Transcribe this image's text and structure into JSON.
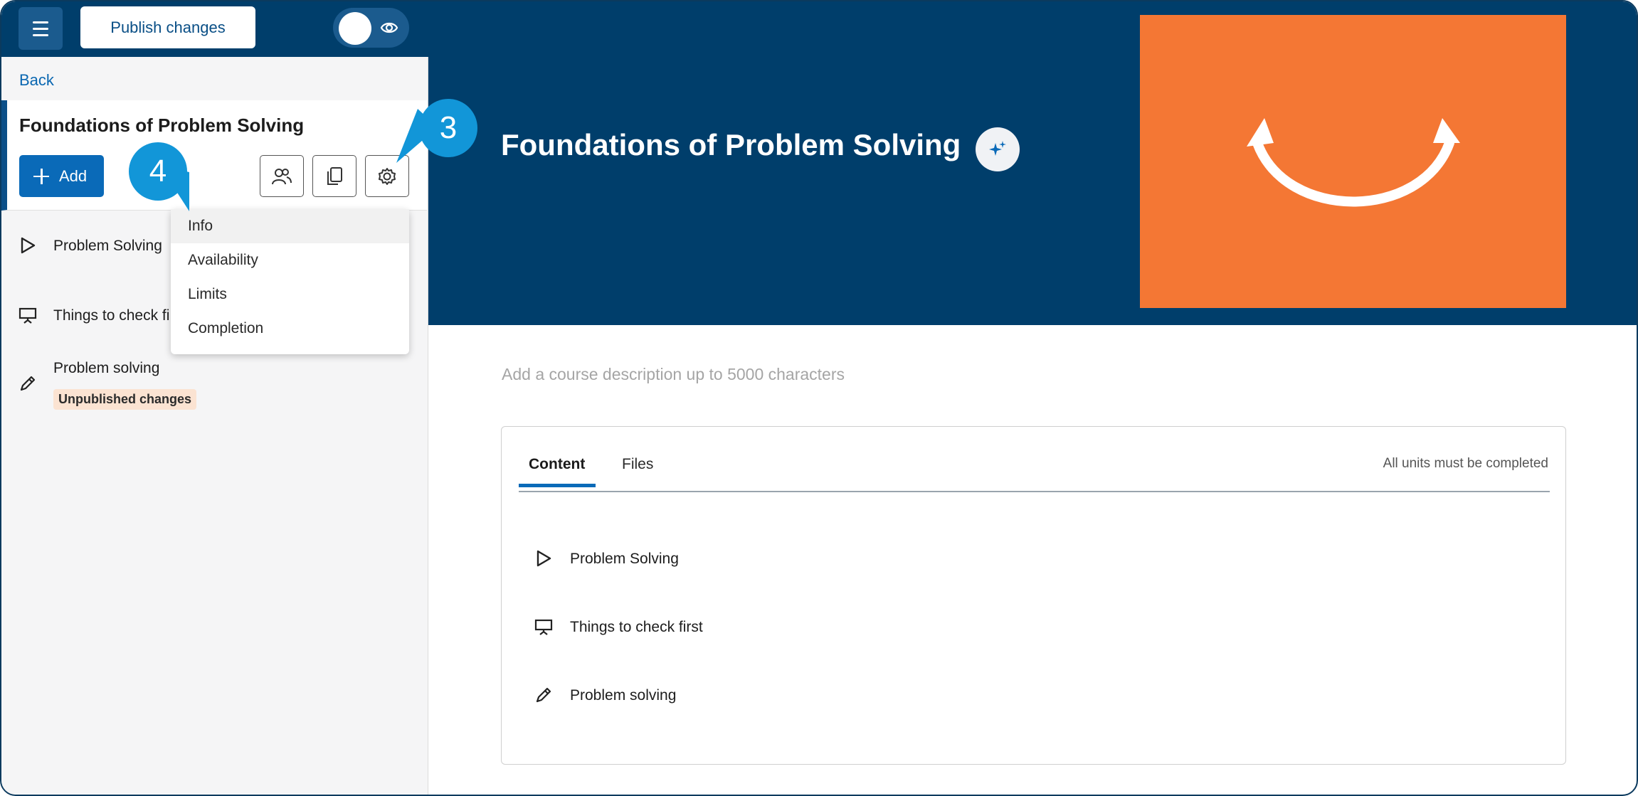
{
  "topbar": {
    "publish_label": "Publish changes"
  },
  "sidebar": {
    "back_label": "Back",
    "course_title": "Foundations of Problem Solving",
    "add_label": "Add",
    "units": [
      {
        "label": "Problem Solving",
        "icon": "play-icon"
      },
      {
        "label": "Things to check fi",
        "icon": "presentation-icon"
      },
      {
        "label": "Problem solving",
        "icon": "pencil-icon",
        "badge": "Unpublished changes"
      }
    ]
  },
  "dropdown": {
    "items": [
      "Info",
      "Availability",
      "Limits",
      "Completion"
    ],
    "hovered": "Info"
  },
  "callouts": {
    "settings": "3",
    "info": "4"
  },
  "main": {
    "course_title": "Foundations of Problem Solving",
    "description_placeholder": "Add a course description up to 5000 characters",
    "tabs": [
      "Content",
      "Files"
    ],
    "active_tab": "Content",
    "completion_note": "All units must be completed",
    "units": [
      {
        "label": "Problem Solving",
        "icon": "play-icon"
      },
      {
        "label": "Things to check first",
        "icon": "presentation-icon"
      },
      {
        "label": "Problem solving",
        "icon": "pencil-icon"
      }
    ]
  },
  "colors": {
    "brand_navy": "#003e6b",
    "accent_blue": "#0a6ab8",
    "callout_blue": "#1296d8",
    "hero_image_orange": "#f47734",
    "badge_bg": "#fbe3d2"
  }
}
